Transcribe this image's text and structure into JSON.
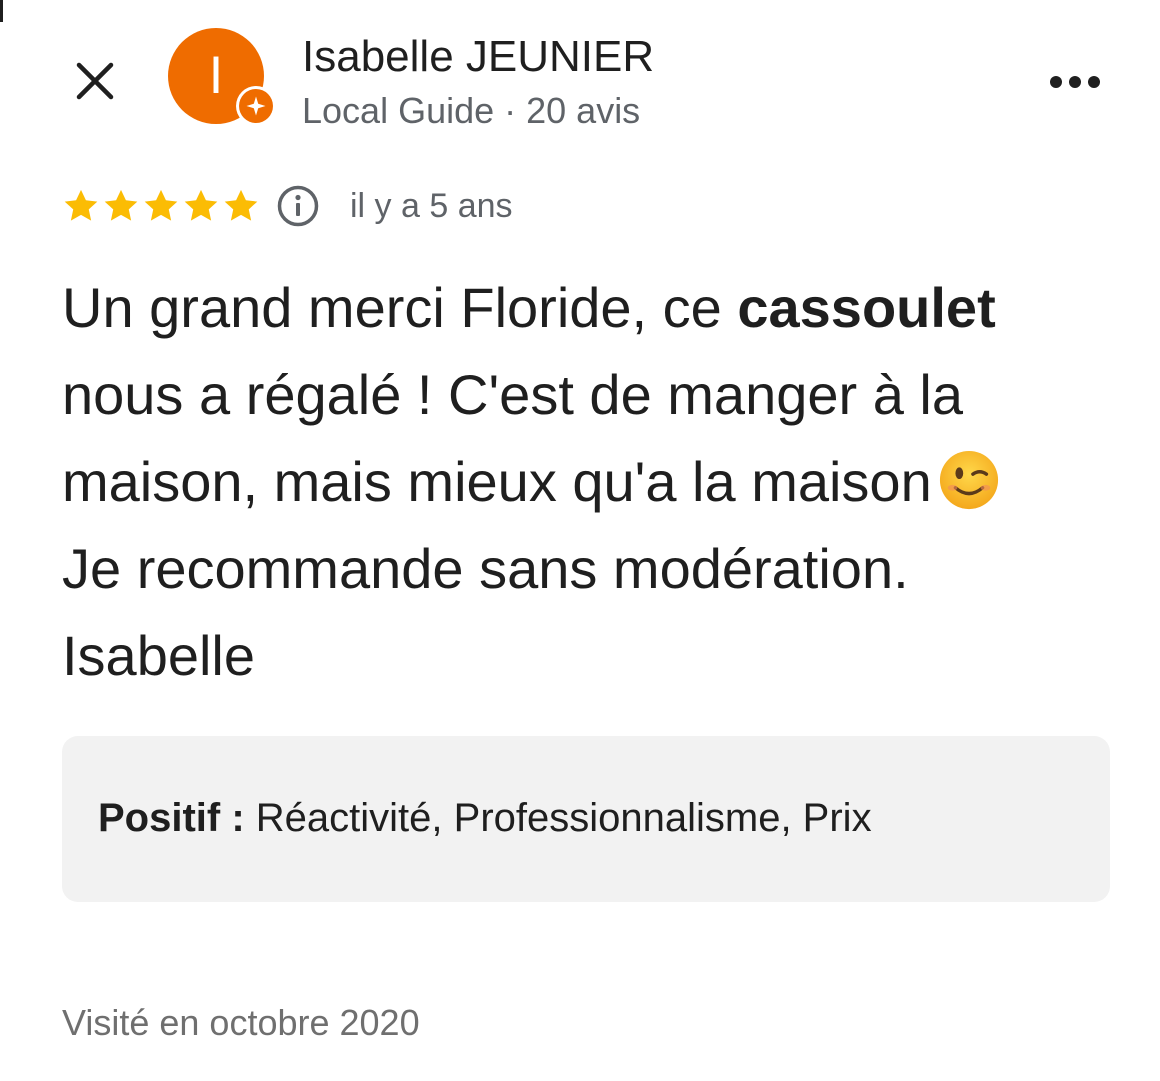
{
  "header": {
    "close_icon": "close-icon",
    "avatar_initial": "I",
    "avatar_color": "#ef6c00",
    "badge_icon": "local-guide-star-icon",
    "author_name": "Isabelle JEUNIER",
    "author_meta": "Local Guide · 20 avis",
    "more_icon": "more-horizontal-icon"
  },
  "rating": {
    "stars": 5,
    "max_stars": 5,
    "star_color": "#fbbc04",
    "info_icon": "info-icon",
    "date": "il y a 5 ans"
  },
  "review": {
    "text_part1": "Un grand merci Floride,  ce ",
    "text_bold": "cassoulet",
    "text_part2": " nous a régalé ! C'est de manger à la maison, mais mieux qu'a la maison",
    "emoji": "winking-face-emoji",
    "text_part3": "Je recommande sans modération.",
    "text_part4": "Isabelle"
  },
  "attributes": {
    "label": "Positif :",
    "values": " Réactivité, Professionnalisme, Prix"
  },
  "visited": "Visité en octobre 2020"
}
